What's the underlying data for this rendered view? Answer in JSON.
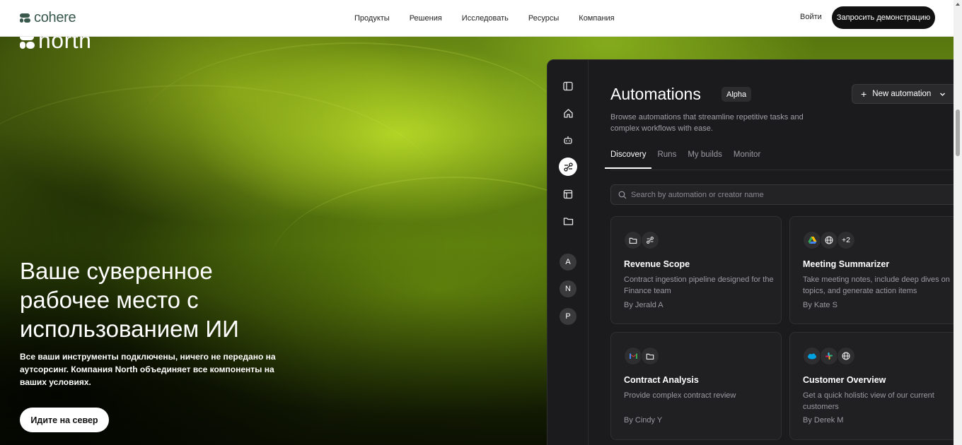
{
  "nav": {
    "logo_text": "cohere",
    "links": [
      "Продукты",
      "Решения",
      "Исследовать",
      "Ресурсы",
      "Компания"
    ],
    "login": "Войти",
    "demo": "Запросить демонстрацию"
  },
  "hero": {
    "brand": "north",
    "title": "Ваше суверенное рабочее место с использованием ИИ",
    "subtitle": "Все ваши инструменты подключены, ничего не передано на аутсорсинг. Компания North объединяет все компоненты на ваших условиях.",
    "cta": "Идите на север"
  },
  "app": {
    "title": "Automations",
    "badge": "Alpha",
    "new_button": "New automation",
    "description": "Browse automations that streamline repetitive tasks and complex workflows with ease.",
    "tabs": [
      "Discovery",
      "Runs",
      "My builds",
      "Monitor"
    ],
    "search_placeholder": "Search by automation or creator name",
    "rail_avatars": [
      "A",
      "N",
      "P"
    ],
    "cards": [
      {
        "title": "Revenue Scope",
        "desc": "Contract ingestion pipeline designed for the Finance team",
        "by": "By Jerald A",
        "icons": [
          "folder-icon",
          "workflow-icon"
        ]
      },
      {
        "title": "Meeting Summarizer",
        "desc": "Take meeting notes, include deep dives on topics, and generate action items",
        "by": "By Kate S",
        "icons": [
          "drive-icon",
          "globe-icon"
        ],
        "extra": "+2"
      },
      {
        "title": "Contract Analysis",
        "desc": "Provide complex contract review",
        "by": "By Cindy Y",
        "icons": [
          "gmail-icon",
          "folder-icon"
        ]
      },
      {
        "title": "Customer Overview",
        "desc": "Get a quick holistic view of our current customers",
        "by": "By Derek M",
        "icons": [
          "salesforce-icon",
          "slack-icon",
          "globe-icon"
        ]
      }
    ]
  },
  "colors": {
    "brand_green": "#39594d",
    "app_bg": "#1b1b1d",
    "card_bg": "#202023",
    "button_dark": "#111111"
  }
}
